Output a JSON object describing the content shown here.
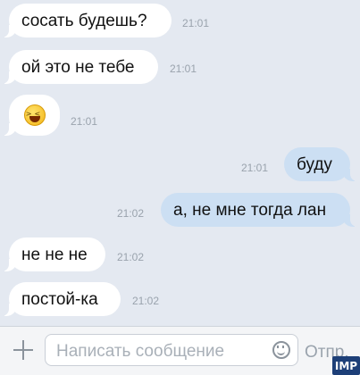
{
  "messages": [
    {
      "dir": "in",
      "text": "сосать будешь?",
      "time": "21:01"
    },
    {
      "dir": "in",
      "text": "ой это не тебе",
      "time": "21:01"
    },
    {
      "dir": "in",
      "text": "",
      "emoji": "grinning-squinting-face",
      "time": "21:01"
    },
    {
      "dir": "out",
      "text": "буду",
      "time": "21:01"
    },
    {
      "dir": "out",
      "text": "а, не мне тогда лан",
      "time": "21:02"
    },
    {
      "dir": "in",
      "text": "не не не",
      "time": "21:02"
    },
    {
      "dir": "in",
      "text": "постой-ка",
      "time": "21:02"
    }
  ],
  "composer": {
    "attach_icon": "plus-icon",
    "placeholder": "Написать сообщение",
    "emoji_icon": "smiley-icon",
    "send_label": "Отпр."
  },
  "watermark": "IMP",
  "colors": {
    "background": "#e4e9f1",
    "incoming_bubble": "#ffffff",
    "outgoing_bubble": "#ccdff3",
    "timestamp": "#9aa3ad"
  }
}
